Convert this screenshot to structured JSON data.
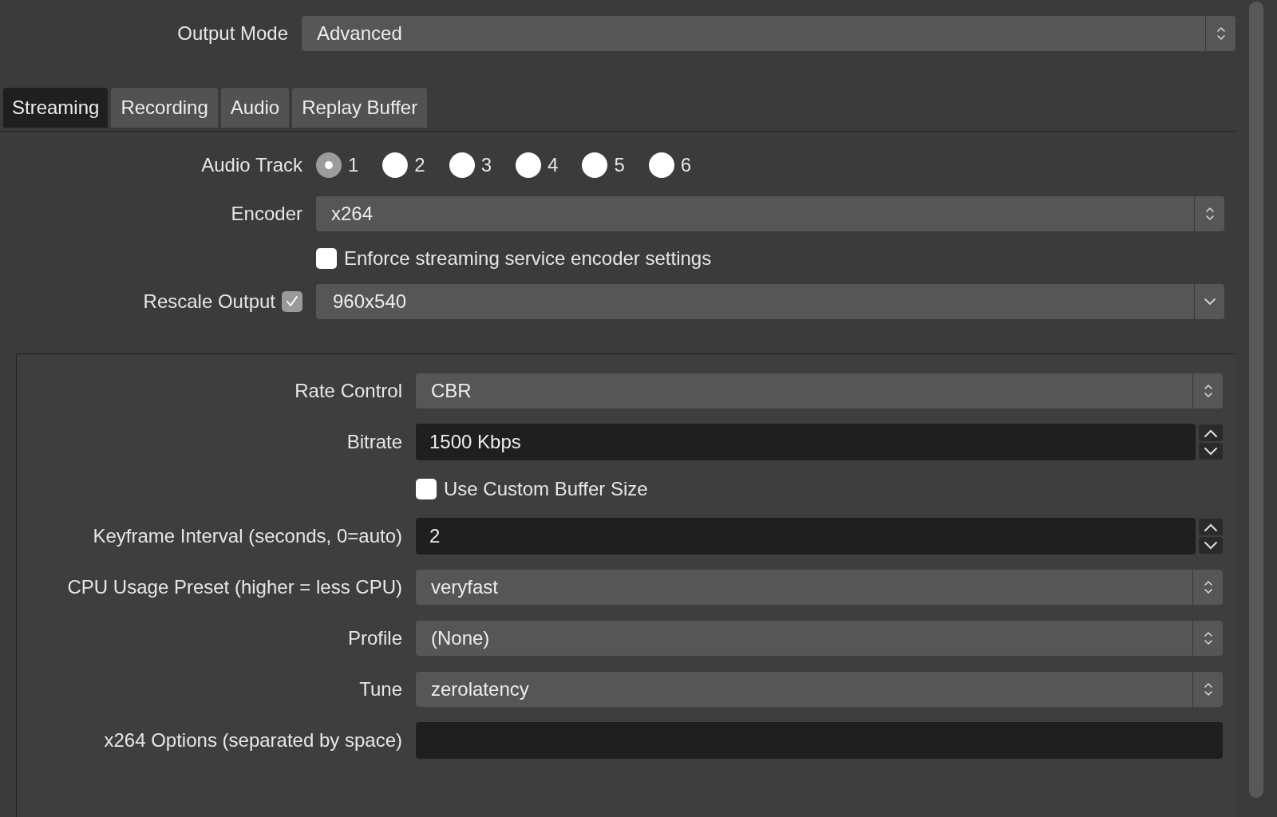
{
  "output_mode": {
    "label": "Output Mode",
    "value": "Advanced"
  },
  "tabs": [
    {
      "label": "Streaming",
      "selected": true
    },
    {
      "label": "Recording",
      "selected": false
    },
    {
      "label": "Audio",
      "selected": false
    },
    {
      "label": "Replay Buffer",
      "selected": false
    }
  ],
  "streaming": {
    "audio_track": {
      "label": "Audio Track",
      "options": [
        {
          "label": "1",
          "selected": true
        },
        {
          "label": "2",
          "selected": false
        },
        {
          "label": "3",
          "selected": false
        },
        {
          "label": "4",
          "selected": false
        },
        {
          "label": "5",
          "selected": false
        },
        {
          "label": "6",
          "selected": false
        }
      ]
    },
    "encoder": {
      "label": "Encoder",
      "value": "x264"
    },
    "enforce": {
      "label": "Enforce streaming service encoder settings",
      "checked": false
    },
    "rescale": {
      "label": "Rescale Output",
      "checked": true,
      "value": "960x540"
    },
    "settings": [
      {
        "kind": "select",
        "label": "Rate Control",
        "value": "CBR"
      },
      {
        "kind": "spin",
        "label": "Bitrate",
        "value": "1500 Kbps"
      },
      {
        "kind": "checkbox",
        "label": "Use Custom Buffer Size",
        "checked": false
      },
      {
        "kind": "spin",
        "label": "Keyframe Interval (seconds, 0=auto)",
        "value": "2"
      },
      {
        "kind": "select",
        "label": "CPU Usage Preset (higher = less CPU)",
        "value": "veryfast"
      },
      {
        "kind": "select",
        "label": "Profile",
        "value": "(None)"
      },
      {
        "kind": "select",
        "label": "Tune",
        "value": "zerolatency"
      },
      {
        "kind": "text",
        "label": "x264 Options (separated by space)"
      }
    ]
  }
}
